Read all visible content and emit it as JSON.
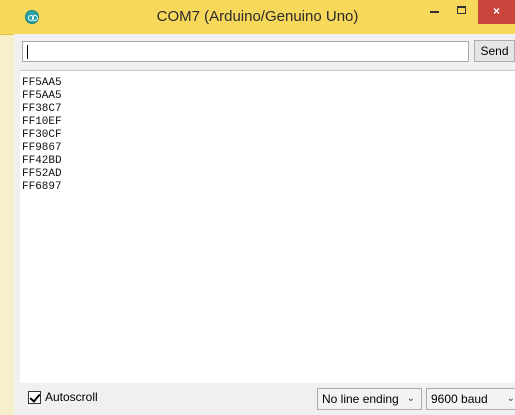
{
  "window": {
    "title": "COM7 (Arduino/Genuino Uno)",
    "close_label": "×",
    "accent": "#f7d85a",
    "close_color": "#c9443b"
  },
  "send": {
    "input_value": "",
    "button_label": "Send"
  },
  "output": {
    "lines": [
      "FF5AA5",
      "FF5AA5",
      "FF38C7",
      "FF10EF",
      "FF30CF",
      "FF9867",
      "FF42BD",
      "FF52AD",
      "FF6897"
    ]
  },
  "footer": {
    "autoscroll_label": "Autoscroll",
    "autoscroll_checked": true,
    "line_ending": "No line ending",
    "baud_rate": "9600 baud",
    "dropdown_icon": "chevron-down-icon"
  }
}
